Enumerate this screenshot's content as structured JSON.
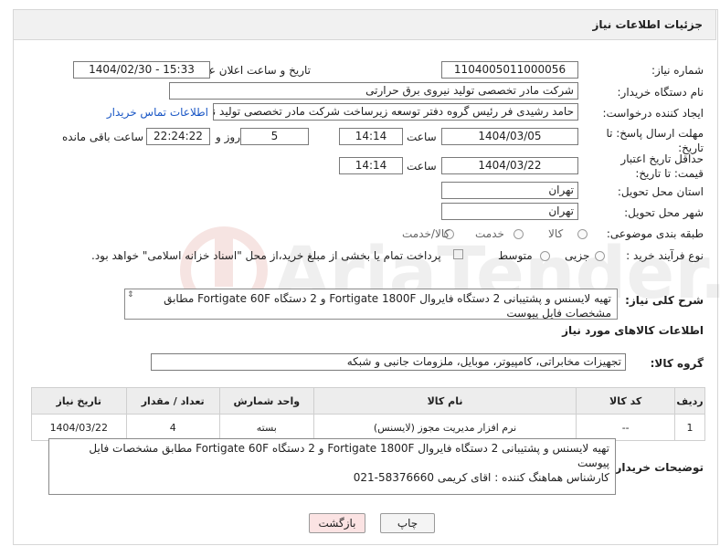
{
  "header": {
    "title": "جزئیات اطلاعات نیاز"
  },
  "form": {
    "need_number_label": "شماره نیاز:",
    "need_number": "1104005011000056",
    "announce_label": "تاریخ و ساعت اعلان عمومی:",
    "announce_value": "1404/02/30 - 15:33",
    "buyer_org_label": "نام دستگاه خریدار:",
    "buyer_org": "شرکت مادر تخصصی تولید نیروی برق حرارتی",
    "requester_label": "ایجاد کننده درخواست:",
    "requester": "حامد رشیدی فر رئیس گروه دفتر توسعه زیرساخت شرکت مادر تخصصی تولید نیرو",
    "contact_link": "اطلاعات تماس خریدار",
    "reply_deadline_label": "مهلت ارسال پاسخ: تا تاریخ:",
    "reply_date": "1404/03/05",
    "time_label": "ساعت",
    "reply_time": "14:14",
    "days_value": "5",
    "day_and_label": "روز و",
    "remaining_time": "22:24:22",
    "remaining_label": "ساعت باقی مانده",
    "price_validity_label": "حداقل تاریخ اعتبار قیمت: تا تاریخ:",
    "price_date": "1404/03/22",
    "price_time": "14:14",
    "province_label": "استان محل تحویل:",
    "province": "تهران",
    "city_label": "شهر محل تحویل:",
    "city": "تهران",
    "category_label": "طبقه بندی موضوعی:",
    "category_options": [
      "کالا",
      "خدمت",
      "کالا/خدمت"
    ],
    "process_label": "نوع فرآیند خرید :",
    "process_options": [
      "جزیی",
      "متوسط"
    ],
    "payment_note": "پرداخت تمام یا بخشی از مبلغ خرید،از محل \"اسناد خزانه اسلامی\" خواهد بود."
  },
  "description": {
    "label": "شرح کلی نیاز:",
    "text": "تهیه لایسنس و پشتیبانی 2 دستگاه فایروال Fortigate 1800F و 2 دستگاه Fortigate 60F مطابق مشخصات فایل پیوست"
  },
  "goods": {
    "section_title": "اطلاعات کالاهای مورد نیاز",
    "group_label": "گروه کالا:",
    "group_value": "تجهیزات مخابراتی، کامپیوتر، موبایل، ملزومات جانبی و شبکه",
    "columns": [
      "ردیف",
      "کد کالا",
      "نام کالا",
      "واحد شمارش",
      "تعداد / مقدار",
      "تاریخ نیاز"
    ],
    "rows": [
      {
        "row": "1",
        "code": "--",
        "name": "نرم افزار مدیریت مجوز (لایسنس)",
        "unit": "بسته",
        "qty": "4",
        "date": "1404/03/22"
      }
    ]
  },
  "buyer_notes": {
    "label": "توضیحات خریدار:",
    "line1": "تهیه لایسنس و پشتیبانی 2 دستگاه فایروال Fortigate 1800F و 2 دستگاه Fortigate 60F مطابق مشخصات فایل پیوست",
    "line2": "کارشناس هماهنگ کننده : اقای کریمی 58376660-021"
  },
  "buttons": {
    "print": "چاپ",
    "back": "بازگشت"
  },
  "watermark": {
    "text": "AriaTender.neT"
  },
  "colors": {
    "link": "#1a57c5",
    "header_bg": "#f1f1f1",
    "back_bg": "#fbe3e3",
    "watermark": "#c0392b"
  }
}
